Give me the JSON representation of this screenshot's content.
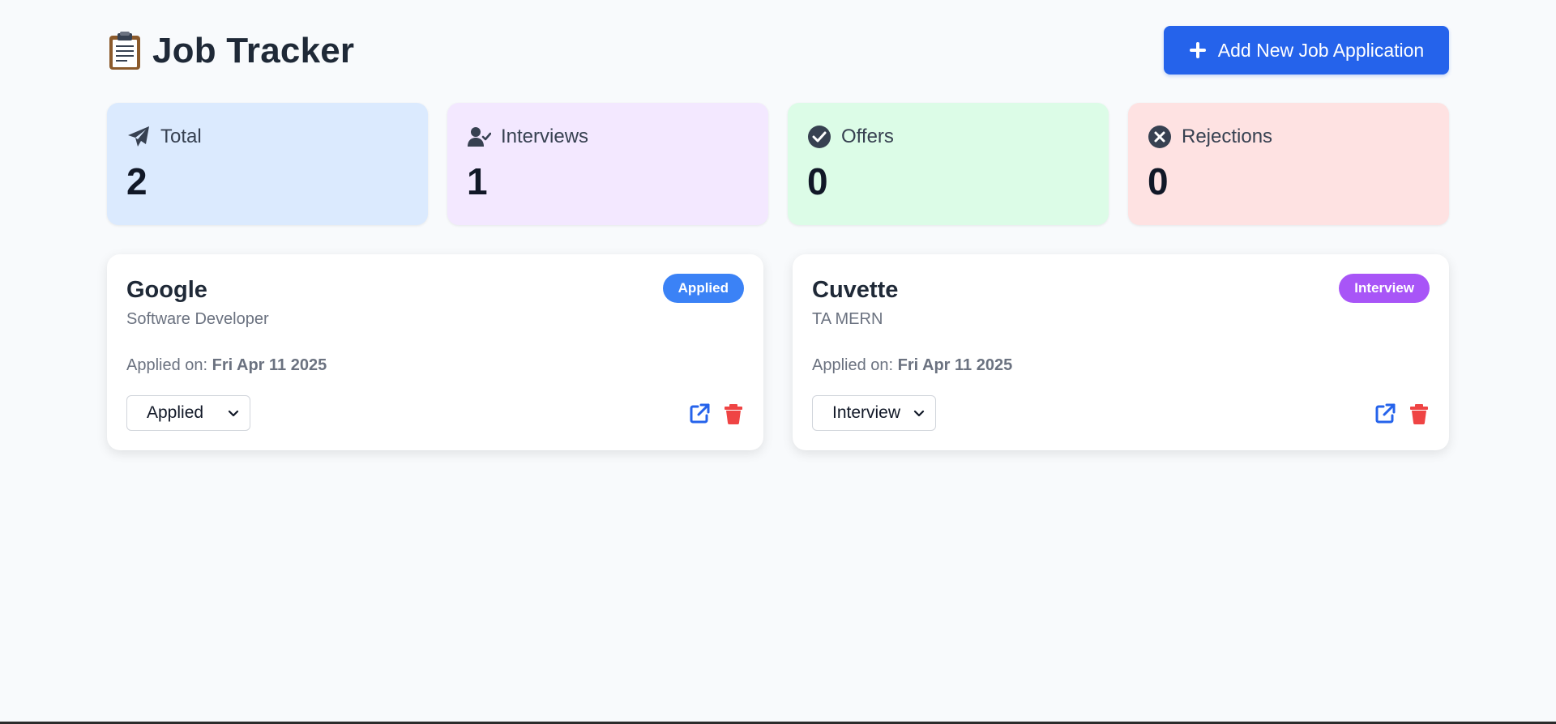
{
  "header": {
    "title": "Job Tracker",
    "add_button_label": "Add New Job Application"
  },
  "stats": [
    {
      "label": "Total",
      "value": "2",
      "icon": "paper-plane-icon",
      "bg": "#dbeafe"
    },
    {
      "label": "Interviews",
      "value": "1",
      "icon": "user-check-icon",
      "bg": "#f3e8ff"
    },
    {
      "label": "Offers",
      "value": "0",
      "icon": "check-circle-icon",
      "bg": "#dcfce7"
    },
    {
      "label": "Rejections",
      "value": "0",
      "icon": "x-circle-icon",
      "bg": "#fee2e2"
    }
  ],
  "jobs": [
    {
      "company": "Google",
      "role": "Software Developer",
      "applied_prefix": "Applied on:",
      "applied_date": "Fri Apr 11 2025",
      "badge": "Applied",
      "status": "Applied",
      "badge_color": "#3b82f6"
    },
    {
      "company": "Cuvette",
      "role": "TA MERN",
      "applied_prefix": "Applied on:",
      "applied_date": "Fri Apr 11 2025",
      "badge": "Interview",
      "status": "Interview",
      "badge_color": "#a855f7"
    }
  ],
  "colors": {
    "primary": "#2563eb",
    "danger": "#ef4444",
    "background": "#f8fafc"
  }
}
